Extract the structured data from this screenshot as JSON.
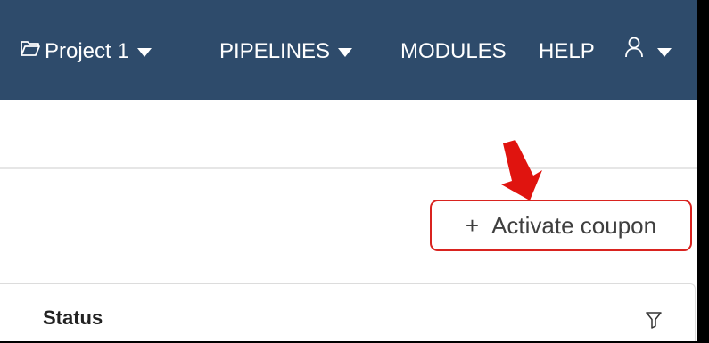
{
  "navbar": {
    "background": "#2e4b6b",
    "project_label": "Project 1",
    "pipelines_label": "PIPELINES",
    "modules_label": "MODULES",
    "help_label": "HELP",
    "icons": {
      "project": "folder-icon",
      "dropdown": "caret-down-icon",
      "user": "user-icon"
    }
  },
  "main": {
    "activate_coupon_label": "Activate coupon",
    "activate_coupon_icon": "plus-icon",
    "highlight_color": "#d9231f",
    "annotation_arrow": "arrow-down-icon"
  },
  "table": {
    "columns": [
      {
        "label": "Status",
        "icon": "filter-icon"
      }
    ]
  }
}
